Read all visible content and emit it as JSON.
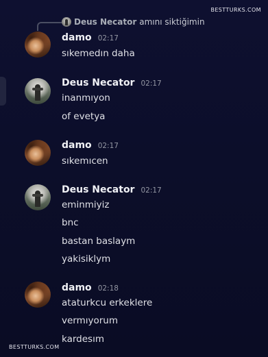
{
  "watermark": "BESTTURKS.COM",
  "reply": {
    "author": "Deus Necator",
    "text": "amını siktiğimin"
  },
  "messages": [
    {
      "author": "damo",
      "time": "02:17",
      "lines": [
        "sıkemedın daha"
      ]
    },
    {
      "author": "Deus Necator",
      "time": "02:17",
      "lines": [
        "inanmıyon",
        "of evetya"
      ]
    },
    {
      "author": "damo",
      "time": "02:17",
      "lines": [
        "sıkemıcen"
      ]
    },
    {
      "author": "Deus Necator",
      "time": "02:17",
      "lines": [
        "eminmiyiz",
        "bnc",
        "bastan baslaym",
        "yakisiklym"
      ]
    },
    {
      "author": "damo",
      "time": "02:18",
      "lines": [
        "ataturkcu erkeklere",
        "vermıyorum",
        "kardesım"
      ]
    }
  ]
}
